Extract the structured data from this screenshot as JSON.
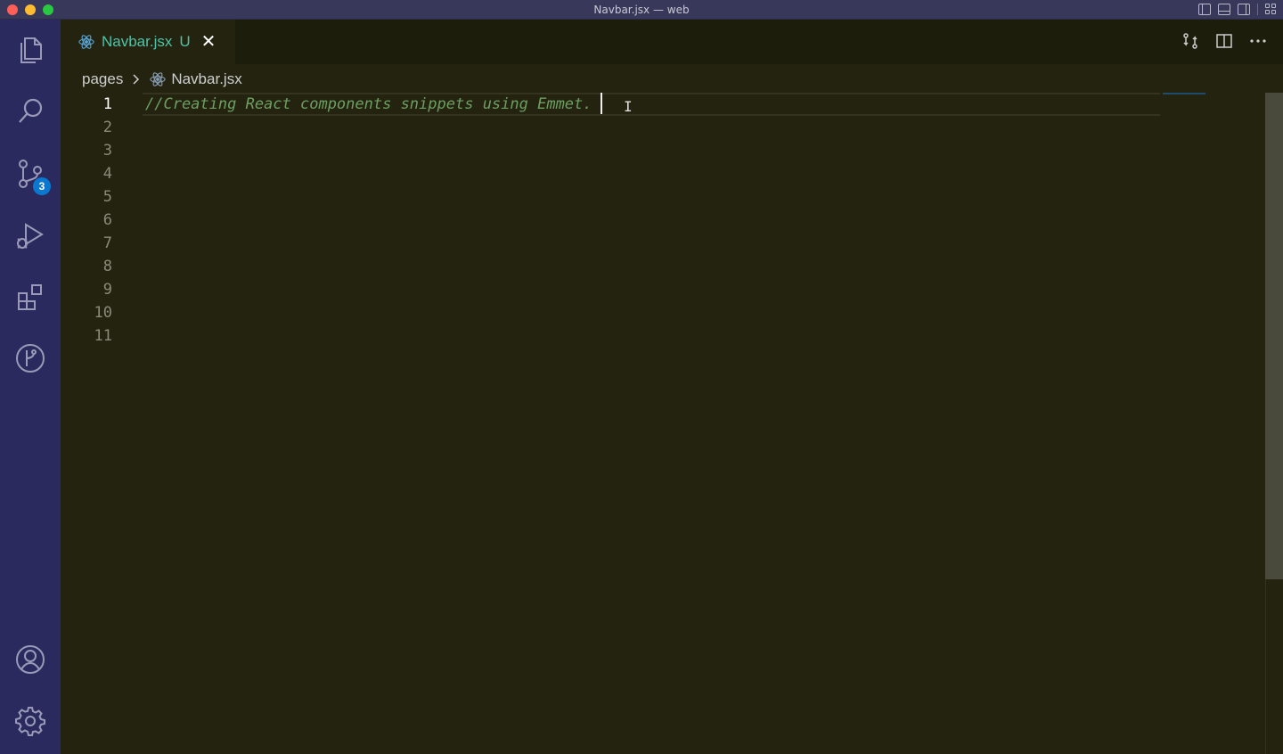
{
  "window": {
    "title": "Navbar.jsx — web"
  },
  "activity_bar": {
    "items": [
      {
        "icon": "files-icon"
      },
      {
        "icon": "search-icon"
      },
      {
        "icon": "source-control-icon",
        "badge": "3"
      },
      {
        "icon": "run-debug-icon"
      },
      {
        "icon": "extensions-icon"
      },
      {
        "icon": "gitlens-icon"
      }
    ],
    "bottom": [
      {
        "icon": "account-icon"
      },
      {
        "icon": "gear-icon"
      }
    ]
  },
  "tab": {
    "label": "Navbar.jsx",
    "modified_marker": "U",
    "close": "✕"
  },
  "breadcrumb": {
    "folder": "pages",
    "separator": ">",
    "file": "Navbar.jsx"
  },
  "editor": {
    "line_numbers": [
      "1",
      "2",
      "3",
      "4",
      "5",
      "6",
      "7",
      "8",
      "9",
      "10",
      "11"
    ],
    "lines": [
      "//Creating React components snippets using Emmet."
    ]
  },
  "colors": {
    "editor_bg": "#23230f",
    "activity_bar_bg": "#2b2a5e",
    "tab_label": "#4fc3a8",
    "comment": "#6d9f63",
    "badge": "#0b78d0"
  }
}
